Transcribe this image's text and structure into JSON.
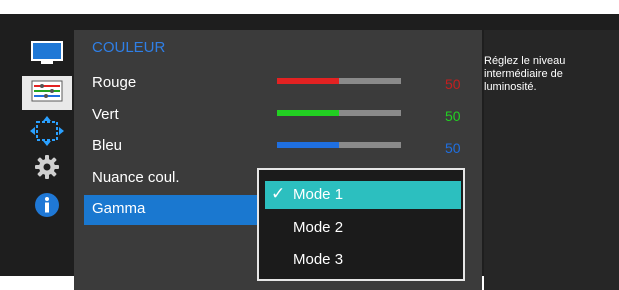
{
  "sidebar": {
    "items": [
      {
        "icon": "monitor-icon"
      },
      {
        "icon": "color-sliders-icon"
      },
      {
        "icon": "resize-arrows-icon"
      },
      {
        "icon": "gear-icon"
      },
      {
        "icon": "info-icon"
      }
    ]
  },
  "main": {
    "title": "COULEUR",
    "rows": [
      {
        "label": "Rouge",
        "value": "50",
        "level": 0.5,
        "color": "#e32222",
        "value_color": "#c41f1f"
      },
      {
        "label": "Vert",
        "value": "50",
        "level": 0.5,
        "color": "#22d022",
        "value_color": "#22d022"
      },
      {
        "label": "Bleu",
        "value": "50",
        "level": 0.5,
        "color": "#1f6fe0",
        "value_color": "#1f6fe0"
      }
    ],
    "tone_label": "Nuance coul.",
    "gamma_label": "Gamma"
  },
  "dropdown": {
    "options": [
      "Mode 1",
      "Mode 2",
      "Mode 3"
    ],
    "selected": "Mode 1",
    "check": "✓"
  },
  "info": {
    "text": "Réglez le niveau intermédiaire de luminosité."
  },
  "colors": {
    "accent_title": "#2f7fe6",
    "highlight": "#1a78d0",
    "selected_option": "#2cbfbf"
  }
}
